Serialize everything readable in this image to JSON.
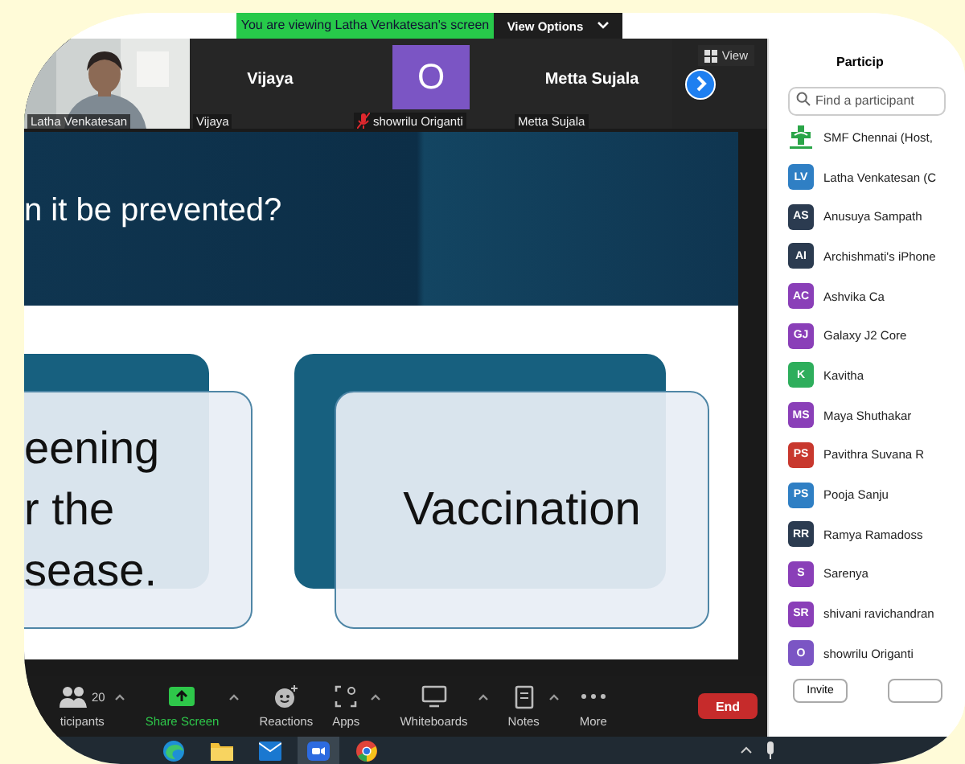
{
  "banner": {
    "text": "You are viewing Latha Venkatesan's screen",
    "options_label": "View Options"
  },
  "gallery": {
    "tiles": [
      {
        "kind": "video",
        "name": "Latha Venkatesan",
        "selected": true
      },
      {
        "kind": "name",
        "title": "Vijaya",
        "name": "Vijaya",
        "selected": false
      },
      {
        "kind": "avatar",
        "initial": "O",
        "color": "#7b55c4",
        "name": "showrilu Origanti",
        "muted": true,
        "selected": false
      },
      {
        "kind": "name",
        "title": "Metta Sujala",
        "name": "Metta Sujala",
        "selected": false
      }
    ],
    "view_label": "View"
  },
  "slide": {
    "title": "n it be prevented?",
    "cards": [
      {
        "lines": [
          "eening",
          "r the",
          "sease."
        ]
      },
      {
        "lines": [
          "Vaccination"
        ]
      }
    ]
  },
  "panel": {
    "title": "Particip",
    "search_placeholder": "Find a participant",
    "participants": [
      {
        "kind": "logo",
        "name": "SMF Chennai (Host,"
      },
      {
        "kind": "avatar",
        "initials": "LV",
        "color": "#2f7fc4",
        "name": "Latha Venkatesan (C"
      },
      {
        "kind": "avatar",
        "initials": "AS",
        "color": "#2b3b50",
        "name": "Anusuya Sampath"
      },
      {
        "kind": "avatar",
        "initials": "AI",
        "color": "#2b3b50",
        "name": "Archishmati's iPhone"
      },
      {
        "kind": "avatar",
        "initials": "AC",
        "color": "#8a3fb8",
        "name": "Ashvika Ca"
      },
      {
        "kind": "avatar",
        "initials": "GJ",
        "color": "#8a3fb8",
        "name": "Galaxy J2 Core"
      },
      {
        "kind": "avatar",
        "initials": "K",
        "color": "#2eae5c",
        "name": "Kavitha"
      },
      {
        "kind": "avatar",
        "initials": "MS",
        "color": "#8a3fb8",
        "name": "Maya Shuthakar"
      },
      {
        "kind": "avatar",
        "initials": "PS",
        "color": "#c8382e",
        "name": "Pavithra Suvana R"
      },
      {
        "kind": "avatar",
        "initials": "PS",
        "color": "#2f7fc4",
        "name": "Pooja Sanju"
      },
      {
        "kind": "avatar",
        "initials": "RR",
        "color": "#2b3b50",
        "name": "Ramya Ramadoss"
      },
      {
        "kind": "avatar",
        "initials": "S",
        "color": "#8a3fb8",
        "name": "Sarenya"
      },
      {
        "kind": "avatar",
        "initials": "SR",
        "color": "#8a3fb8",
        "name": "shivani ravichandran"
      },
      {
        "kind": "avatar",
        "initials": "O",
        "color": "#7b55c4",
        "name": "showrilu Origanti"
      }
    ],
    "invite_label": "Invite"
  },
  "toolbar": {
    "items": [
      {
        "kind": "participants",
        "label": "ticipants",
        "count": "20"
      },
      {
        "kind": "share",
        "label": "Share Screen"
      },
      {
        "kind": "reactions",
        "label": "Reactions"
      },
      {
        "kind": "apps",
        "label": "Apps"
      },
      {
        "kind": "whiteboards",
        "label": "Whiteboards"
      },
      {
        "kind": "notes",
        "label": "Notes"
      },
      {
        "kind": "more",
        "label": "More"
      }
    ],
    "end_label": "End"
  },
  "taskbar": {
    "apps": [
      {
        "kind": "edge",
        "selected": false
      },
      {
        "kind": "folder",
        "selected": false
      },
      {
        "kind": "mail",
        "selected": false
      },
      {
        "kind": "zoom",
        "selected": true
      },
      {
        "kind": "chrome",
        "selected": false
      }
    ]
  }
}
